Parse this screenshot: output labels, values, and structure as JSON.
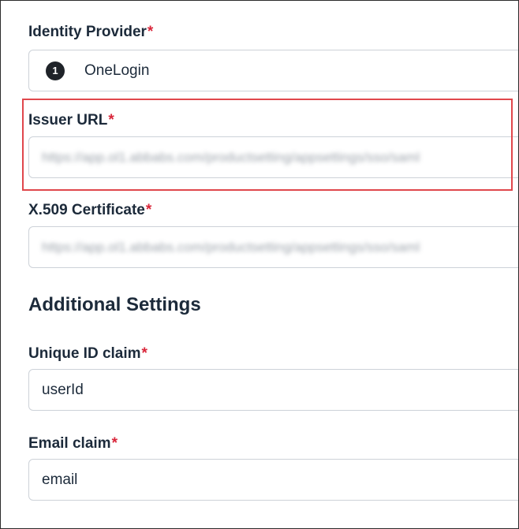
{
  "identity_provider": {
    "label": "Identity Provider",
    "required_mark": "*",
    "icon": "onelogin-logo-icon",
    "icon_glyph": "1",
    "value": "OneLogin"
  },
  "issuer_url": {
    "label": "Issuer URL",
    "required_mark": "*",
    "value": "https://app.ol1.abbabs.com/productsetting/appsettings/sso/saml"
  },
  "x509_certificate": {
    "label": "X.509 Certificate",
    "required_mark": "*",
    "value": "https://app.ol1.abbabs.com/productsetting/appsettings/sso/saml"
  },
  "additional_settings": {
    "title": "Additional Settings"
  },
  "unique_id_claim": {
    "label": "Unique ID claim",
    "required_mark": "*",
    "value": "userId"
  },
  "email_claim": {
    "label": "Email claim",
    "required_mark": "*",
    "value": "email"
  },
  "colors": {
    "required": "#d9263a",
    "highlight_border": "#e0474c",
    "label_text": "#1c2a3a",
    "field_border": "#cdd2d8"
  }
}
